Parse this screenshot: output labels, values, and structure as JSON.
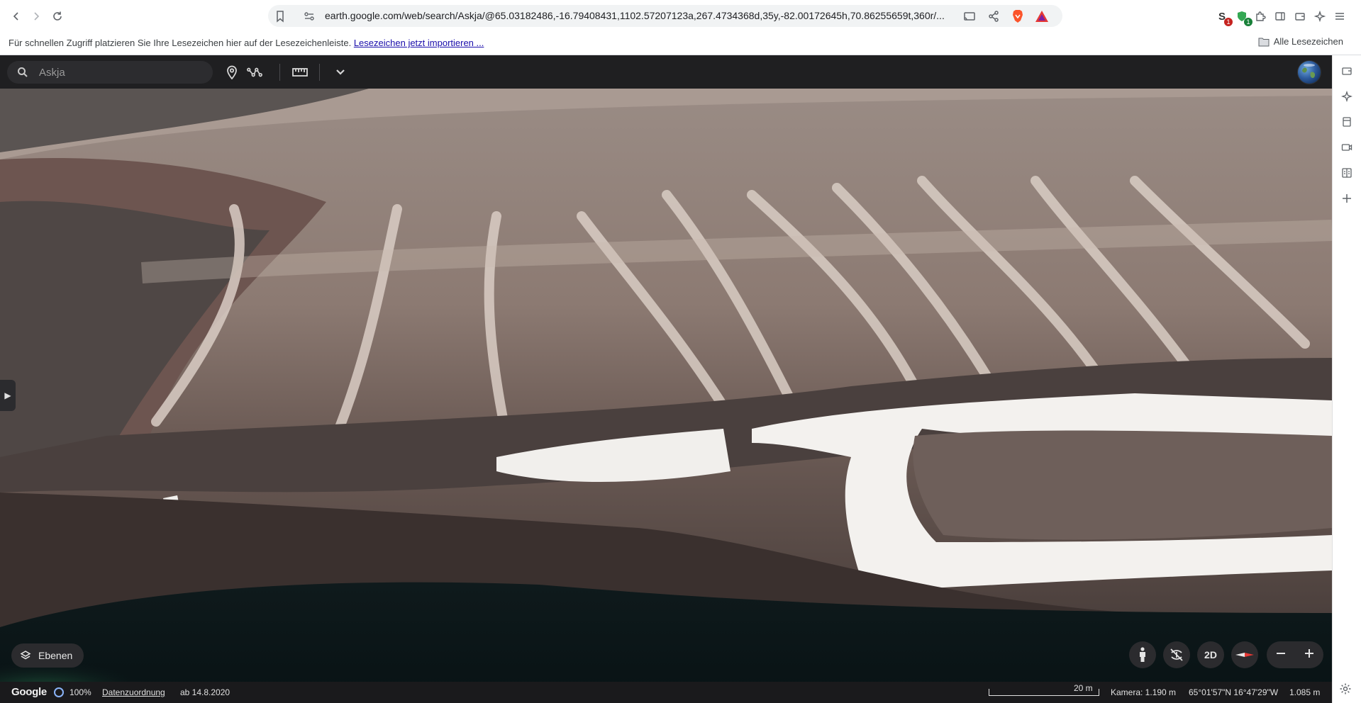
{
  "browser": {
    "url": "earth.google.com/web/search/Askja/@65.03182486,-16.79408431,1102.57207123a,267.4734368d,35y,-82.00172645h,70.86255659t,360r/...",
    "bookmarks_hint": "Für schnellen Zugriff platzieren Sie Ihre Lesezeichen hier auf der Lesezeichenleiste.",
    "bookmarks_import_link": "Lesezeichen jetzt importieren ...",
    "all_bookmarks_label": "Alle Lesezeichen",
    "extension_badges": [
      "1",
      "1"
    ],
    "colors": {
      "brave_accent": "#fb542b",
      "badge_red": "#c5221f",
      "badge_green": "#188038"
    }
  },
  "earth": {
    "search": {
      "placeholder": "Askja"
    },
    "toolbar_icons": [
      "search-icon",
      "placemark-icon",
      "path-icon",
      "ruler-icon",
      "chevron-down-icon"
    ],
    "layers_button_label": "Ebenen",
    "view_mode_label": "2D",
    "status": {
      "brand": "Google",
      "loading_percent": "100%",
      "attribution_link": "Datenzuordnung",
      "imagery_date": "ab 14.8.2020",
      "scale_label": "20 m",
      "camera_altitude": "Kamera: 1.190 m",
      "coordinates": "65°01'57\"N 16°47'29\"W",
      "elevation": "1.085 m"
    },
    "colors": {
      "toolbar_bg": "#1f1f21",
      "control_bg": "#2b2b2e",
      "progress_ring": "#8ab4f8"
    }
  }
}
